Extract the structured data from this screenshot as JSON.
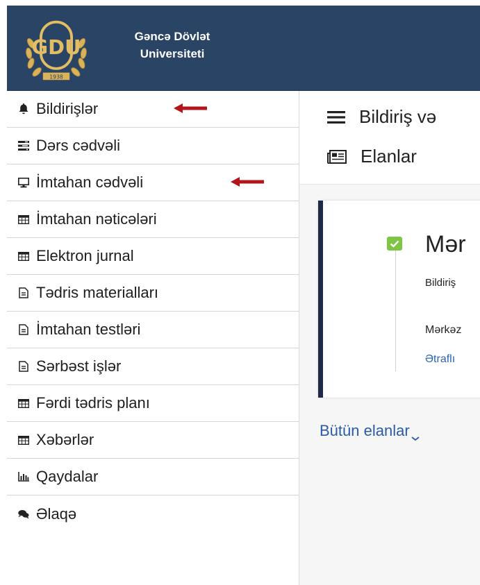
{
  "header": {
    "university_line1": "Gəncə Dövlət",
    "university_line2": "Universiteti",
    "logo_letters": "GDU",
    "logo_year": "1938",
    "brand_color": "#2a4466"
  },
  "sidebar": {
    "items": [
      {
        "label": "Bildirişlər",
        "icon": "bell-icon"
      },
      {
        "label": "Dərs cədvəli",
        "icon": "tasks-icon"
      },
      {
        "label": "İmtahan cədvəli",
        "icon": "monitor-icon"
      },
      {
        "label": "İmtahan nəticələri",
        "icon": "table-icon"
      },
      {
        "label": "Elektron jurnal",
        "icon": "table-icon"
      },
      {
        "label": "Tədris materialları",
        "icon": "document-icon"
      },
      {
        "label": "İmtahan testləri",
        "icon": "document-icon"
      },
      {
        "label": "Sərbəst işlər",
        "icon": "document-icon"
      },
      {
        "label": "Fərdi tədris planı",
        "icon": "table-icon"
      },
      {
        "label": "Xəbərlər",
        "icon": "table-icon"
      },
      {
        "label": "Qaydalar",
        "icon": "bar-chart-icon"
      },
      {
        "label": "Əlaqə",
        "icon": "comments-icon"
      }
    ],
    "annotation_arrow_color": "#b3151b"
  },
  "main": {
    "menu_text": "Bildiriş və",
    "elanlar_text": "Elanlar",
    "card": {
      "title": "Mər",
      "category": "Bildiriş",
      "body": "Mərkəz",
      "more_link": "Ətraflı"
    },
    "all_ads": "Bütün elanlar"
  },
  "colors": {
    "accent_link": "#2b64b2",
    "check_green": "#7dc542",
    "card_border": "#1e2a48"
  }
}
